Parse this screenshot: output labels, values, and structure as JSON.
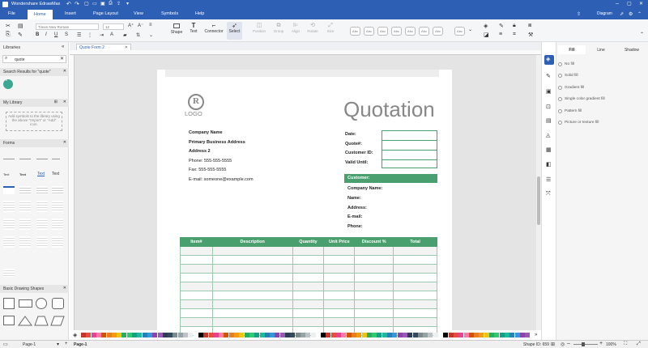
{
  "app": {
    "title": "Wondershare EdrawMax",
    "user": "Diagram"
  },
  "menu": [
    "File",
    "Home",
    "Insert",
    "Page Layout",
    "View",
    "Symbols",
    "Help"
  ],
  "ribbon": {
    "font": "Times New Roman",
    "size": "12",
    "tools": [
      "Shape",
      "Text",
      "Connector",
      "Select"
    ],
    "disabled_tools": [
      "Position",
      "Group",
      "Align",
      "Rotate",
      "Size"
    ],
    "style_label": "Abc"
  },
  "left": {
    "libraries": "Libraries",
    "search_value": "quote",
    "search_results": "Search Results for \"quote\"",
    "my_library": "My Library",
    "my_library_hint": "Add symbols to the library using the above \"Import\" or \"Add\" icon.",
    "forms": "Forms",
    "basic_shapes": "Basic Drawing Shapes",
    "form_samples": [
      "Text",
      "Text"
    ]
  },
  "doc": {
    "tab": "Quote Form 2"
  },
  "quote": {
    "logo": "LOGO",
    "title": "Quotation",
    "company": [
      "Company Name",
      "Primary Business Address",
      "Address 2",
      "Phone: 555-555-5555",
      "Fax: 555-555-5555",
      "E-mail: someone@example.com"
    ],
    "meta_labels": [
      "Date:",
      "Quote#:",
      "Customer ID:",
      "Valid Until:"
    ],
    "customer_header": "Customer:",
    "customer_fields": [
      "Company Name:",
      "Name:",
      "Address:",
      "E-mail:",
      "Phone:"
    ],
    "columns": [
      "Item#",
      "Description",
      "Quantity",
      "Unit Price",
      "Discount %",
      "Total"
    ],
    "accent": "#4a9f6f"
  },
  "right": {
    "tabs": [
      "Fill",
      "Line",
      "Shadow"
    ],
    "options": [
      "No fill",
      "Solid fill",
      "Gradient fill",
      "Single color gradient fill",
      "Pattern fill",
      "Picture or texture fill"
    ]
  },
  "status": {
    "page_sel": "Page-1",
    "page_tab": "Page-1",
    "shape_id": "Shape ID: 659",
    "zoom": "100%"
  }
}
